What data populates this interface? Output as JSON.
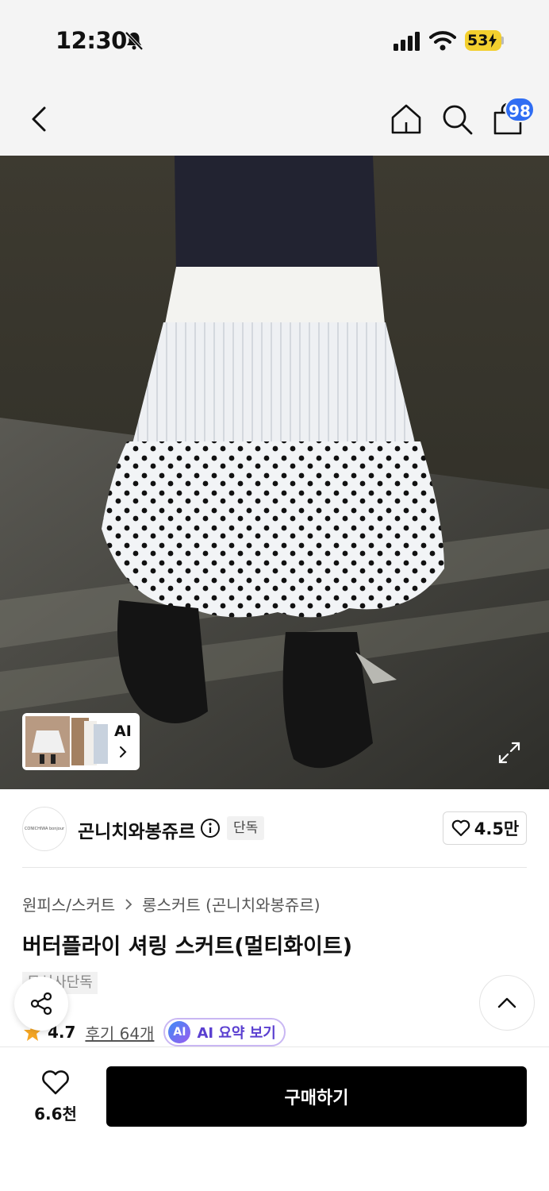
{
  "status_bar": {
    "time": "12:30",
    "battery": "53"
  },
  "nav": {
    "cart_count": "98"
  },
  "gallery": {
    "ai_label": "AI"
  },
  "brand": {
    "name": "곤니치와봉쥬르",
    "logo_text": "CONICHIWA bonjour",
    "exclusive_chip": "단독",
    "likes": "4.5만"
  },
  "product": {
    "breadcrumb": [
      "원피스/스커트",
      "롱스커트 (곤니치와봉쥬르)"
    ],
    "title": "버터플라이 셔링 스커트(멀티화이트)",
    "tag": "무신사단독",
    "rating": "4.7",
    "reviews": "후기 64개",
    "ai_badge": "AI",
    "ai_summary": "AI 요약 보기"
  },
  "bottom": {
    "wish_count": "6.6천",
    "buy_label": "구매하기"
  },
  "colors": {
    "accent_blue": "#2f6df3",
    "battery_yellow": "#f3cf2e",
    "ai_purple": "#5a3fd0",
    "star": "#f5a623"
  }
}
